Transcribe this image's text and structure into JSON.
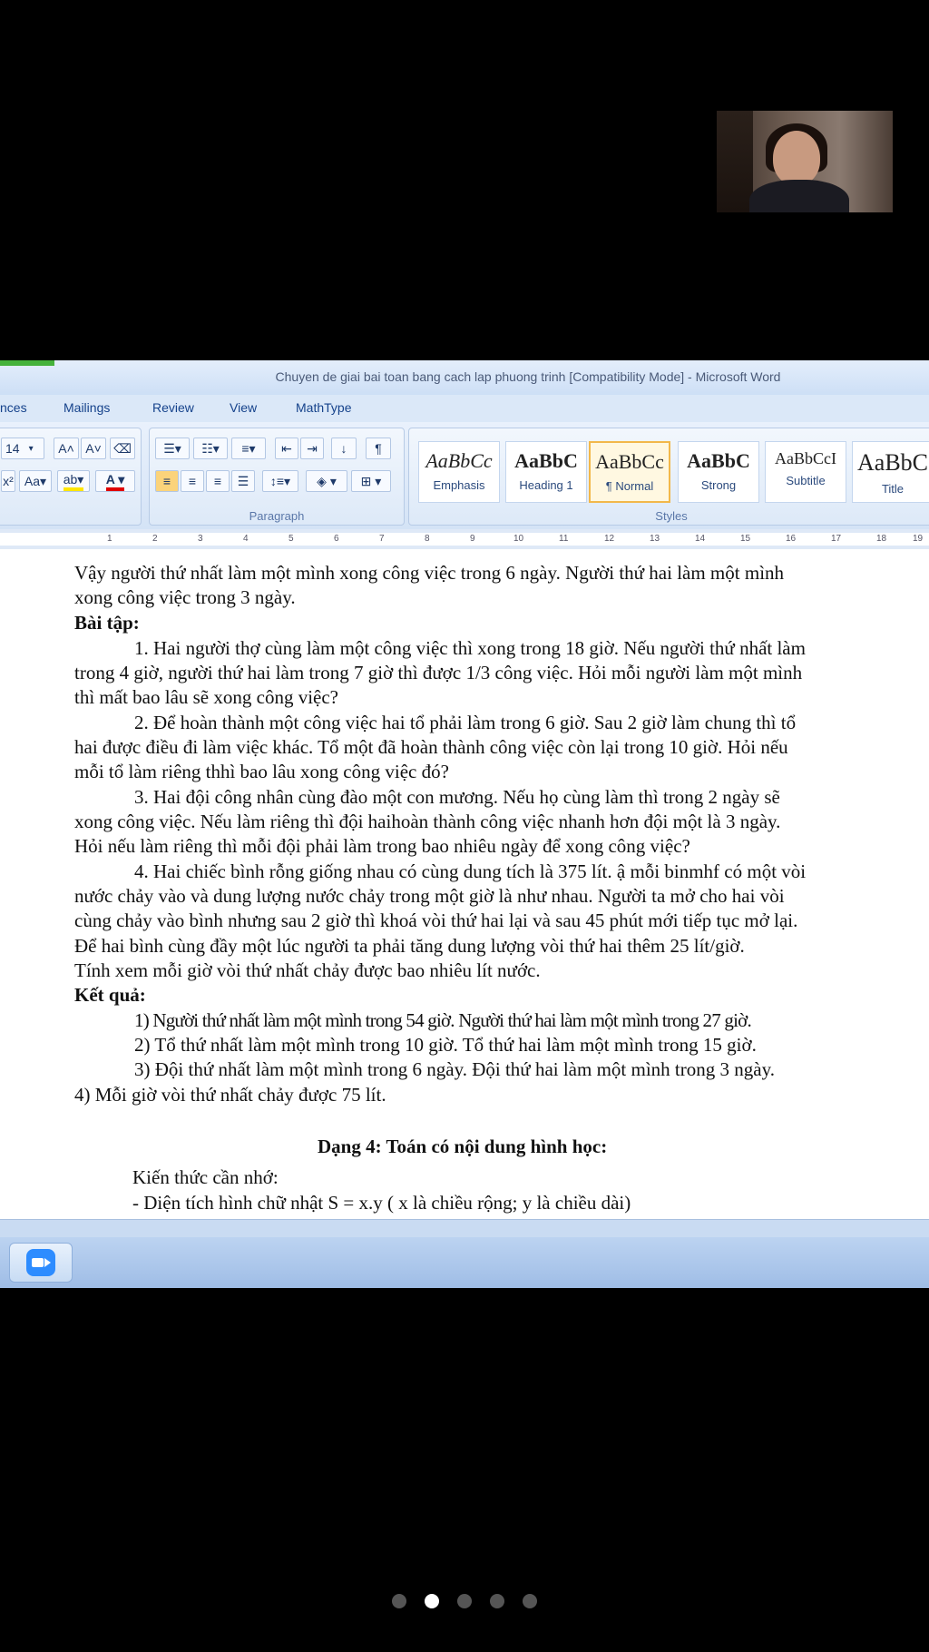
{
  "word": {
    "window_title": "Chuyen de giai bai toan bang cach lap phuong trinh [Compatibility Mode] - Microsoft Word",
    "tabs": [
      "nces",
      "Mailings",
      "Review",
      "View",
      "MathType"
    ],
    "font_size": "14",
    "groups": {
      "paragraph": "Paragraph",
      "styles": "Styles"
    },
    "styles": [
      {
        "preview": "AaBbCc",
        "name": "Emphasis"
      },
      {
        "preview": "AaBbC",
        "name": "Heading 1"
      },
      {
        "preview": "AaBbCc",
        "name": "¶ Normal"
      },
      {
        "preview": "AaBbC",
        "name": "Strong"
      },
      {
        "preview": "AaBbCcI",
        "name": "Subtitle"
      },
      {
        "preview": "AaBbC",
        "name": "Title"
      }
    ],
    "ruler": [
      "1",
      "2",
      "3",
      "4",
      "5",
      "6",
      "7",
      "8",
      "9",
      "10",
      "11",
      "12",
      "13",
      "14",
      "15",
      "16",
      "17",
      "18",
      "19"
    ]
  },
  "document": {
    "lines": [
      "Vậy người thứ nhất làm  một mình xong công việc  trong 6 ngày. Người thứ hai làm một mình",
      "xong công việc trong 3 ngày.",
      "Bài tập:",
      "1. Hai người thợ cùng làm một công việc thì xong trong 18 giờ. Nếu người thứ nhất làm",
      "trong 4 giờ, người thứ hai làm trong 7 giờ thì được 1/3 công việc. Hỏi mỗi người làm một mình",
      "thì mất bao lâu sẽ xong công việc?",
      "2. Để hoàn thành một công việc hai tổ phải làm trong 6 giờ. Sau 2 giờ làm chung thì tổ",
      "hai được điều đi làm việc khác. Tổ một đã hoàn thành công việc còn lại trong 10 giờ. Hỏi nếu",
      "mỗi tổ làm riêng  thhì bao lâu xong công việc đó?",
      "3. Hai đội công nhân cùng đào một con mương. Nếu họ cùng làm thì trong 2 ngày sẽ",
      "xong công việc. Nếu làm riêng thì đội haihoàn thành công việc nhanh hơn đội một là 3 ngày.",
      "Hỏi nếu làm riêng thì mỗi đội phải làm trong bao nhiêu ngày để xong công việc?",
      "4. Hai chiếc bình rỗng giống nhau có cùng dung tích là 375 lít. ậ mỗi binmhf có một vòi",
      "nước  chảy vào và dung lượng nước chảy trong một giờ là như nhau. Người ta mở cho hai vòi",
      "cùng chảy vào bình nhưng sau 2 giờ thì khoá vòi thứ hai lại và sau 45 phút mới tiếp tục mở lại.",
      "Để hai bình cùng đầy một lúc người ta phải tăng dung lượng vòi  thứ hai thêm 25 lít/giờ.",
      "Tính xem mỗi giờ vòi thứ nhất chảy được bao nhiêu lít nước.",
      "Kết quả:",
      "1) Người thứ nhất làm một mình trong 54 giờ. Người thứ hai làm một mình trong 27 giờ.",
      "2) Tổ thứ nhất làm một mình trong 10 giờ. Tổ thứ hai  làm một mình trong 15 giờ.",
      "3) Đội thứ nhất làm một mình trong 6 ngày. Đội thứ hai làm một mình trong 3 ngày.",
      "4) Mỗi giờ vòi thứ nhất chảy được 75 lít.",
      "Dạng 4: Toán có  nội dung hình học:",
      "Kiến thức cần nhớ:",
      "- Diện tích hình chữ nhật S = x.y ( x là chiều rộng; y là chiều dài)"
    ]
  },
  "pager": {
    "count": 5,
    "active": 1
  }
}
